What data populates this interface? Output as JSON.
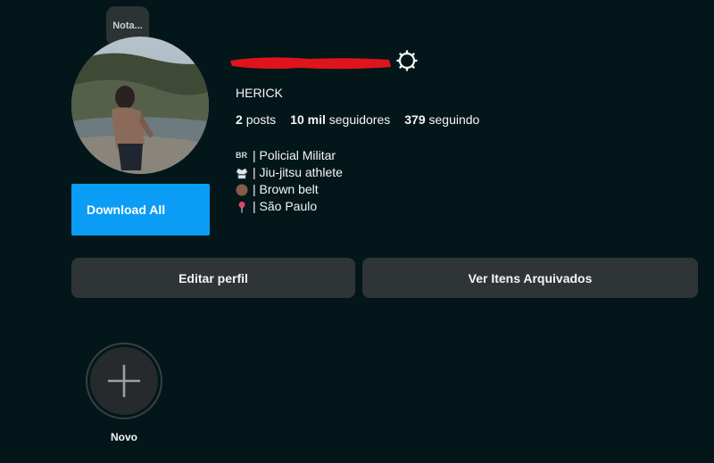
{
  "profile": {
    "note_label": "Nota...",
    "display_name": "HERICK",
    "stats": {
      "posts_count": "2",
      "posts_label": "posts",
      "followers_count": "10 mil",
      "followers_label": "seguidores",
      "following_count": "379",
      "following_label": "seguindo"
    },
    "bio": [
      {
        "prefix": "BR",
        "text": "| Policial Militar"
      },
      {
        "icon": "gi-uniform-icon",
        "text": "| Jiu-jitsu athlete"
      },
      {
        "icon": "brown-circle-icon",
        "text": "| Brown belt"
      },
      {
        "icon": "pin-icon",
        "text": "| São Paulo"
      }
    ]
  },
  "buttons": {
    "download_all": "Download All",
    "edit_profile": "Editar perfil",
    "archived": "Ver Itens Arquivados"
  },
  "highlights": {
    "new_label": "Novo"
  },
  "colors": {
    "background": "#03171a",
    "accent": "#0b9cf6",
    "button_bg": "#2f3537",
    "redaction": "#e0141c"
  }
}
